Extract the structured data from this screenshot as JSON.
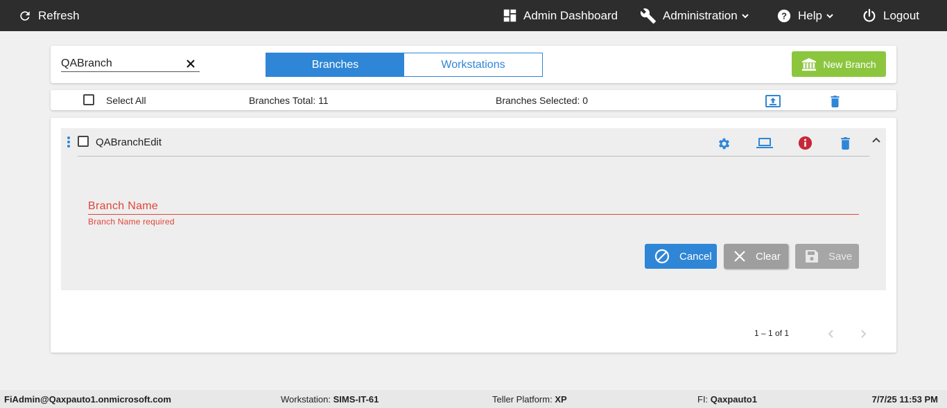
{
  "topbar": {
    "refresh_label": "Refresh",
    "admin_dashboard_label": "Admin Dashboard",
    "administration_label": "Administration",
    "help_label": "Help",
    "logout_label": "Logout"
  },
  "search": {
    "value": "QABranch"
  },
  "tabs": [
    {
      "label": "Branches",
      "active": true
    },
    {
      "label": "Workstations",
      "active": false
    }
  ],
  "new_branch_label": "New Branch",
  "summary": {
    "select_all_label": "Select All",
    "branches_total": "Branches Total: 11",
    "branches_selected": "Branches Selected: 0"
  },
  "branch_item": {
    "name": "QABranchEdit",
    "field_label": "Branch Name",
    "field_error": "Branch Name required",
    "cancel_label": "Cancel",
    "clear_label": "Clear",
    "save_label": "Save"
  },
  "pagination": {
    "range_label": "1 – 1 of 1"
  },
  "footer": {
    "user": "FiAdmin@Qaxpauto1.onmicrosoft.com",
    "workstation_label": "Workstation:",
    "workstation_value": "SIMS-IT-61",
    "teller_platform_label": "Teller Platform:",
    "teller_platform_value": "XP",
    "fi_label": "FI:",
    "fi_value": "Qaxpauto1",
    "datetime": "7/7/25 11:53 PM"
  },
  "colors": {
    "topbar_bg": "#2d2d2d",
    "accent_blue": "#2f86d6",
    "new_branch_green": "#8cc63f",
    "error_red": "#e0443a",
    "info_red": "#c62839"
  },
  "icons": {
    "refresh": "refresh-icon",
    "dashboard": "dashboard-icon",
    "administration": "wrench-icon",
    "help": "help-circle-icon",
    "logout": "power-icon",
    "new_branch": "bank-icon",
    "upload": "upload-icon",
    "delete": "trash-icon",
    "settings": "gear-icon",
    "workstation": "laptop-icon",
    "info": "info-icon",
    "collapse": "chevron-up-icon"
  }
}
